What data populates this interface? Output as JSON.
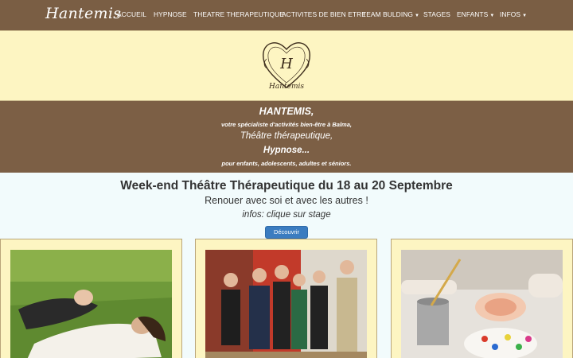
{
  "nav": {
    "brand": "Hantemis",
    "items": [
      {
        "label": "ACCUEIL",
        "dropdown": false
      },
      {
        "label": "HYPNOSE",
        "dropdown": false
      },
      {
        "label": "THEATRE THERAPEUTIQUE",
        "dropdown": false
      },
      {
        "label": "ACTIVITES DE BIEN ETRE",
        "dropdown": false
      },
      {
        "label": "TEAM BULDING",
        "dropdown": true
      },
      {
        "label": "STAGES",
        "dropdown": false
      },
      {
        "label": "ENFANTS",
        "dropdown": true
      },
      {
        "label": "INFOS",
        "dropdown": true
      }
    ]
  },
  "logo": {
    "monogram": "H",
    "name": "Hantemis"
  },
  "tagline": {
    "title": "HANTEMIS,",
    "line1": "votre spécialiste d'activités bien-être à Balma,",
    "line2": "Théâtre thérapeutique,",
    "line3": "Hypnose...",
    "line4": "pour enfants, adolescents, adultes et séniors."
  },
  "event": {
    "headline": "Week-end Théâtre Thérapeutique du 18 au 20 Septembre",
    "headline_suffix": ":",
    "subline": "Renouer avec soi et avec les autres !",
    "infos": "infos: clique sur stage",
    "button": "Découvrir"
  },
  "cards": [
    {
      "icon": "relaxation-photo"
    },
    {
      "icon": "group-costume-photo"
    },
    {
      "icon": "painting-activity-photo"
    }
  ],
  "colors": {
    "nav_bg": "#7a5e44",
    "cream": "#fdf5c2",
    "button": "#3b7cc0",
    "page_bg": "#f2fbfc"
  }
}
